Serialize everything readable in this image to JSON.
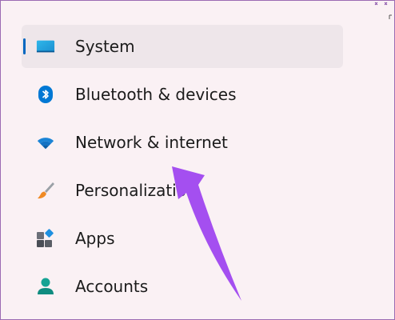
{
  "nav": {
    "items": [
      {
        "label": "System",
        "icon": "monitor-icon",
        "selected": true
      },
      {
        "label": "Bluetooth & devices",
        "icon": "bluetooth-icon",
        "selected": false
      },
      {
        "label": "Network & internet",
        "icon": "wifi-icon",
        "selected": false
      },
      {
        "label": "Personalization",
        "icon": "paintbrush-icon",
        "selected": false
      },
      {
        "label": "Apps",
        "icon": "apps-icon",
        "selected": false
      },
      {
        "label": "Accounts",
        "icon": "account-icon",
        "selected": false
      }
    ]
  },
  "colors": {
    "accent": "#0067c0",
    "arrow": "#a44ff0",
    "frame_border": "#9b6bb3",
    "background": "#faf1f4"
  }
}
